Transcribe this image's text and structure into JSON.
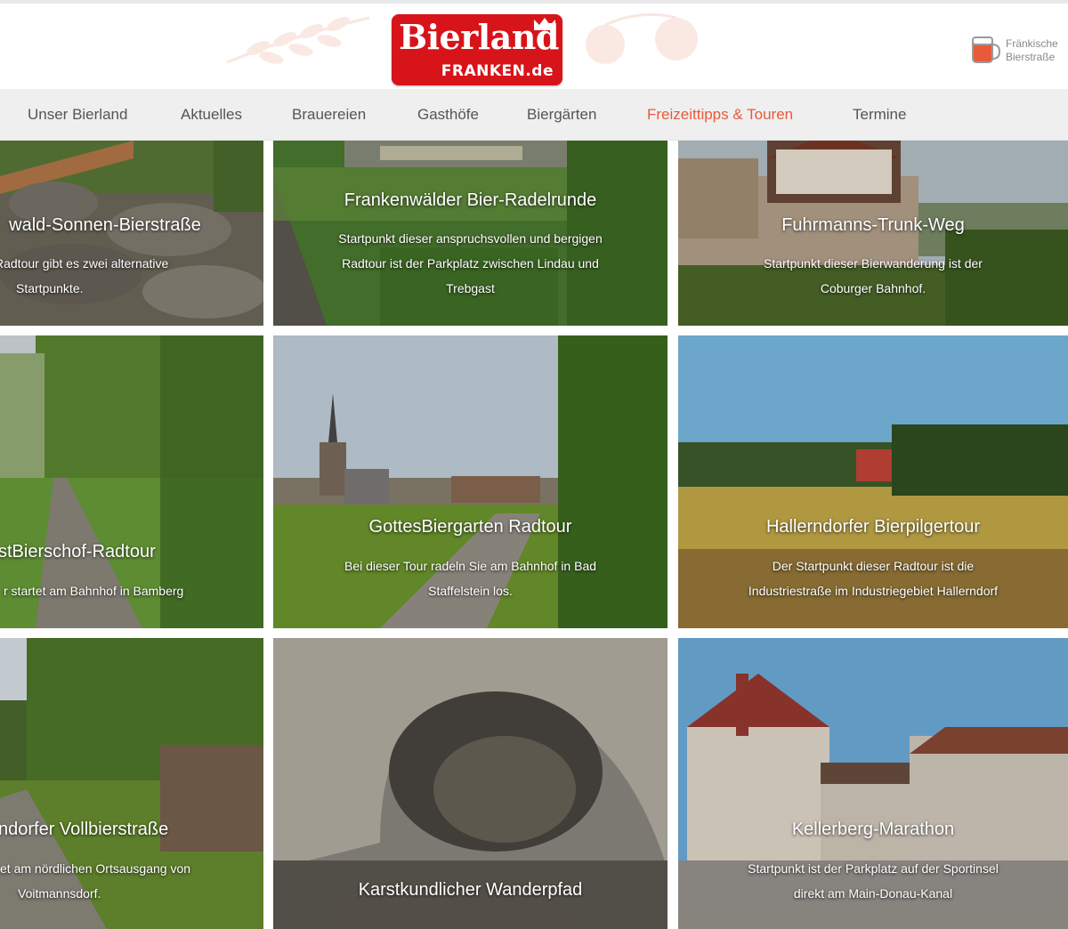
{
  "header": {
    "logo_main": "Bierland",
    "logo_sub": "FRANKEN.de",
    "partner_line1": "Fränkische",
    "partner_line2": "Bierstraße"
  },
  "nav": {
    "items": [
      {
        "label": "Unser Bierland",
        "active": false
      },
      {
        "label": "Aktuelles",
        "active": false
      },
      {
        "label": "Brauereien",
        "active": false
      },
      {
        "label": "Gasthöfe",
        "active": false
      },
      {
        "label": "Biergärten",
        "active": false
      },
      {
        "label": "Freizeittipps & Touren",
        "active": true
      },
      {
        "label": "Termine",
        "active": false
      }
    ]
  },
  "tours": [
    {
      "title": "wald-Sonnen-Bierstraße",
      "desc_lines": [
        "Radtour gibt es zwei alternative",
        "Startpunkte."
      ]
    },
    {
      "title": "Frankenwälder Bier-Radelrunde",
      "desc_lines": [
        "Startpunkt dieser anspruchsvollen und bergigen",
        "Radtour ist der Parkplatz zwischen Lindau und",
        "Trebgast"
      ]
    },
    {
      "title": "Fuhrmanns-Trunk-Weg",
      "desc_lines": [
        "Startpunkt dieser Bierwanderung ist der",
        "Coburger Bahnhof."
      ]
    },
    {
      "title": "stBierschof-Radtour",
      "desc_lines": [
        "r startet am Bahnhof in Bamberg"
      ]
    },
    {
      "title": "GottesBiergarten Radtour",
      "desc_lines": [
        "Bei dieser Tour radeln Sie am Bahnhof in Bad",
        "Staffelstein los."
      ]
    },
    {
      "title": "Hallerndorfer Bierpilgertour",
      "desc_lines": [
        "Der Startpunkt dieser Radtour ist die",
        "Industriestraße im Industriegebiet Hallerndorf"
      ]
    },
    {
      "title": "ndorfer Vollbierstraße",
      "desc_lines": [
        "et am nördlichen Ortsausgang von",
        "Voitmannsdorf."
      ]
    },
    {
      "title": "Karstkundlicher Wanderpfad",
      "desc_lines": []
    },
    {
      "title": "Kellerberg-Marathon",
      "desc_lines": [
        "Startpunkt ist der Parkplatz auf der Sportinsel",
        "direkt am Main-Donau-Kanal"
      ]
    }
  ],
  "colors": {
    "brand_red": "#d7141a",
    "nav_active": "#e85a3c",
    "nav_bg": "#efefef"
  }
}
